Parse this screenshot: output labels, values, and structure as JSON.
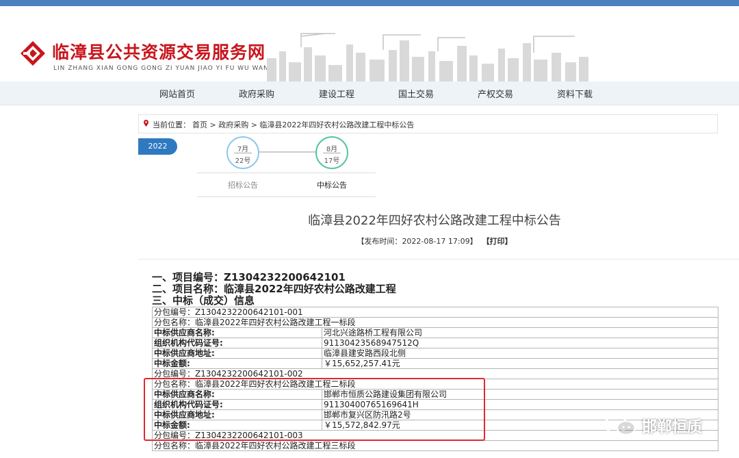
{
  "header": {
    "site_title": "临漳县公共资源交易服务网",
    "site_pinyin": "LIN ZHANG XIAN GONG GONG ZI YUAN JIAO YI FU WU WANG",
    "brand_color": "#c8161d",
    "topbar_color": "#4a7fc0"
  },
  "nav": {
    "items": [
      "网站首页",
      "政府采购",
      "建设工程",
      "国土交易",
      "产权交易",
      "资料下载"
    ]
  },
  "breadcrumb": {
    "label": "当前位置：",
    "path": "首页 > 政府采购 > 临漳县2022年四好农村公路改建工程中标公告",
    "icon": "location-pin-icon"
  },
  "timeline": {
    "year": "2022",
    "steps": [
      {
        "month": "7月",
        "day": "22号",
        "label": "招标公告",
        "active": false
      },
      {
        "month": "8月",
        "day": "17号",
        "label": "中标公告",
        "active": true
      }
    ]
  },
  "article": {
    "title": "临漳县2022年四好农村公路改建工程中标公告",
    "meta_open": "【发布时间：",
    "publish_time": "2022-08-17 17:09",
    "meta_close": "】",
    "print_label": "【打印】",
    "sections": [
      {
        "title": "一、项目编号：Z1304232200642101"
      },
      {
        "title": "二、项目名称：临漳县2022年四好农村公路改建工程"
      },
      {
        "title": "三、中标（成交）信息"
      }
    ],
    "packages": [
      {
        "number": "分包编号：Z1304232200642101-001",
        "name": "分包名称：临漳县2022年四好农村公路改建工程一标段",
        "rows": [
          {
            "label": "中标供应商名称:",
            "value": "河北兴途路桥工程有限公司"
          },
          {
            "label": "组织机构代码证号:",
            "value": "91130423568947512Q"
          },
          {
            "label": "中标供应商地址:",
            "value": "临漳县建安路西段北侧"
          },
          {
            "label": "中标金额:",
            "value": "￥15,652,257.41元"
          }
        ]
      },
      {
        "number": "分包编号：Z1304232200642101-002",
        "name": "分包名称：临漳县2022年四好农村公路改建工程二标段",
        "rows": [
          {
            "label": "中标供应商名称:",
            "value": "邯郸市恒质公路建设集团有限公司"
          },
          {
            "label": "组织机构代码证号:",
            "value": "91130400765169641H"
          },
          {
            "label": "中标供应商地址:",
            "value": "邯郸市复兴区防汛路2号"
          },
          {
            "label": "中标金额:",
            "value": "￥15,572,842.97元"
          }
        ]
      },
      {
        "number": "分包编号：Z1304232200642101-003",
        "name": "分包名称：临漳县2022年四好农村公路改建工程三标段",
        "rows": []
      }
    ]
  },
  "watermark": {
    "text": "邯郸恒质",
    "icon": "wechat-icon"
  },
  "highlight_color": "#e0282e"
}
